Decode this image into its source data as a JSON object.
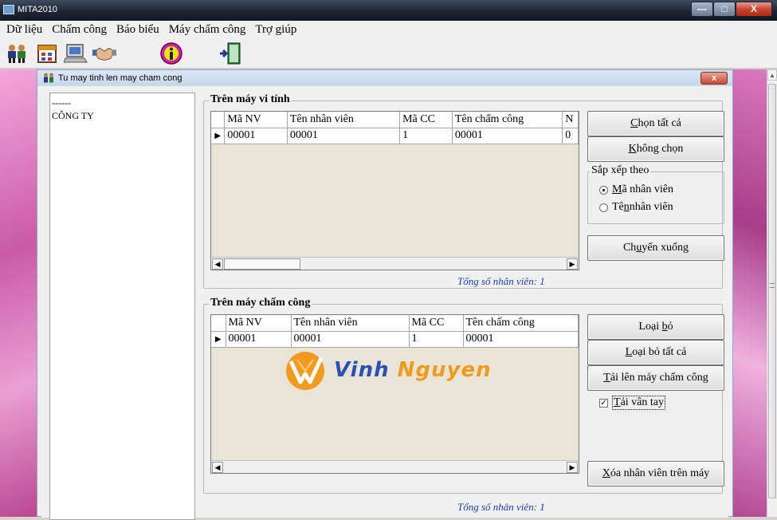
{
  "window": {
    "title": "MITA2010",
    "min": "—",
    "max": "□",
    "close": "X"
  },
  "menu": [
    "Dữ liệu",
    "Chấm công",
    "Báo biểu",
    "Máy chấm công",
    "Trợ giúp"
  ],
  "toolbar": {
    "icons": [
      "employees-icon",
      "calendar-icon",
      "computer-icon",
      "handshake-icon",
      "info-icon",
      "exit-door-icon"
    ]
  },
  "child": {
    "title": "Tu may tinh len may cham cong",
    "close": "x"
  },
  "tree": [
    "------",
    "CÔNG TY"
  ],
  "computer_section": {
    "caption": "Trên máy vi tính",
    "columns": [
      "Mã NV",
      "Tên nhân viên",
      "Mã CC",
      "Tên chấm công",
      "N"
    ],
    "rows": [
      [
        "00001",
        "00001",
        "1",
        "00001",
        "0"
      ]
    ],
    "select_all": {
      "pre": "",
      "key": "C",
      "post": "họn tất cả"
    },
    "deselect": {
      "pre": "",
      "key": "K",
      "post": "hông chọn"
    },
    "sort_caption": "Sắp xếp theo",
    "sort_by_id": {
      "pre": "",
      "key": "M",
      "post": "ã nhân viên"
    },
    "sort_by_name": {
      "pre": "Tê",
      "key": "n",
      "post": " nhân viên"
    },
    "sort_selected": "id",
    "move_down": {
      "pre": "Ch",
      "key": "u",
      "post": "yển xuống"
    },
    "total": "Tổng số nhân viên: 1"
  },
  "device_section": {
    "caption": "Trên máy chấm công",
    "columns": [
      "Mã NV",
      "Tên nhân viên",
      "Mã CC",
      "Tên chấm công"
    ],
    "rows": [
      [
        "00001",
        "00001",
        "1",
        "00001"
      ]
    ],
    "remove": {
      "pre": "Loại ",
      "key": "b",
      "post": "ỏ"
    },
    "remove_all": {
      "pre": "",
      "key": "L",
      "post": "oại bỏ tất cả"
    },
    "upload": {
      "pre": "",
      "key": "T",
      "post": "ải lên máy chấm công"
    },
    "upload_fingerprint": {
      "pre": "",
      "key": "T",
      "post": "ải vân tay"
    },
    "upload_fingerprint_checked": true,
    "delete_on_device": {
      "pre": "",
      "key": "X",
      "post": "óa nhân viên trên máy"
    },
    "total": "Tổng số nhân viên: 1",
    "watermark": {
      "part1": "Vinh ",
      "part2": "Nguyen"
    }
  },
  "colors": {
    "watermark_orange": "#f39a1e",
    "watermark_blue": "#2b4fb8",
    "total_text": "#1a3fb0"
  }
}
